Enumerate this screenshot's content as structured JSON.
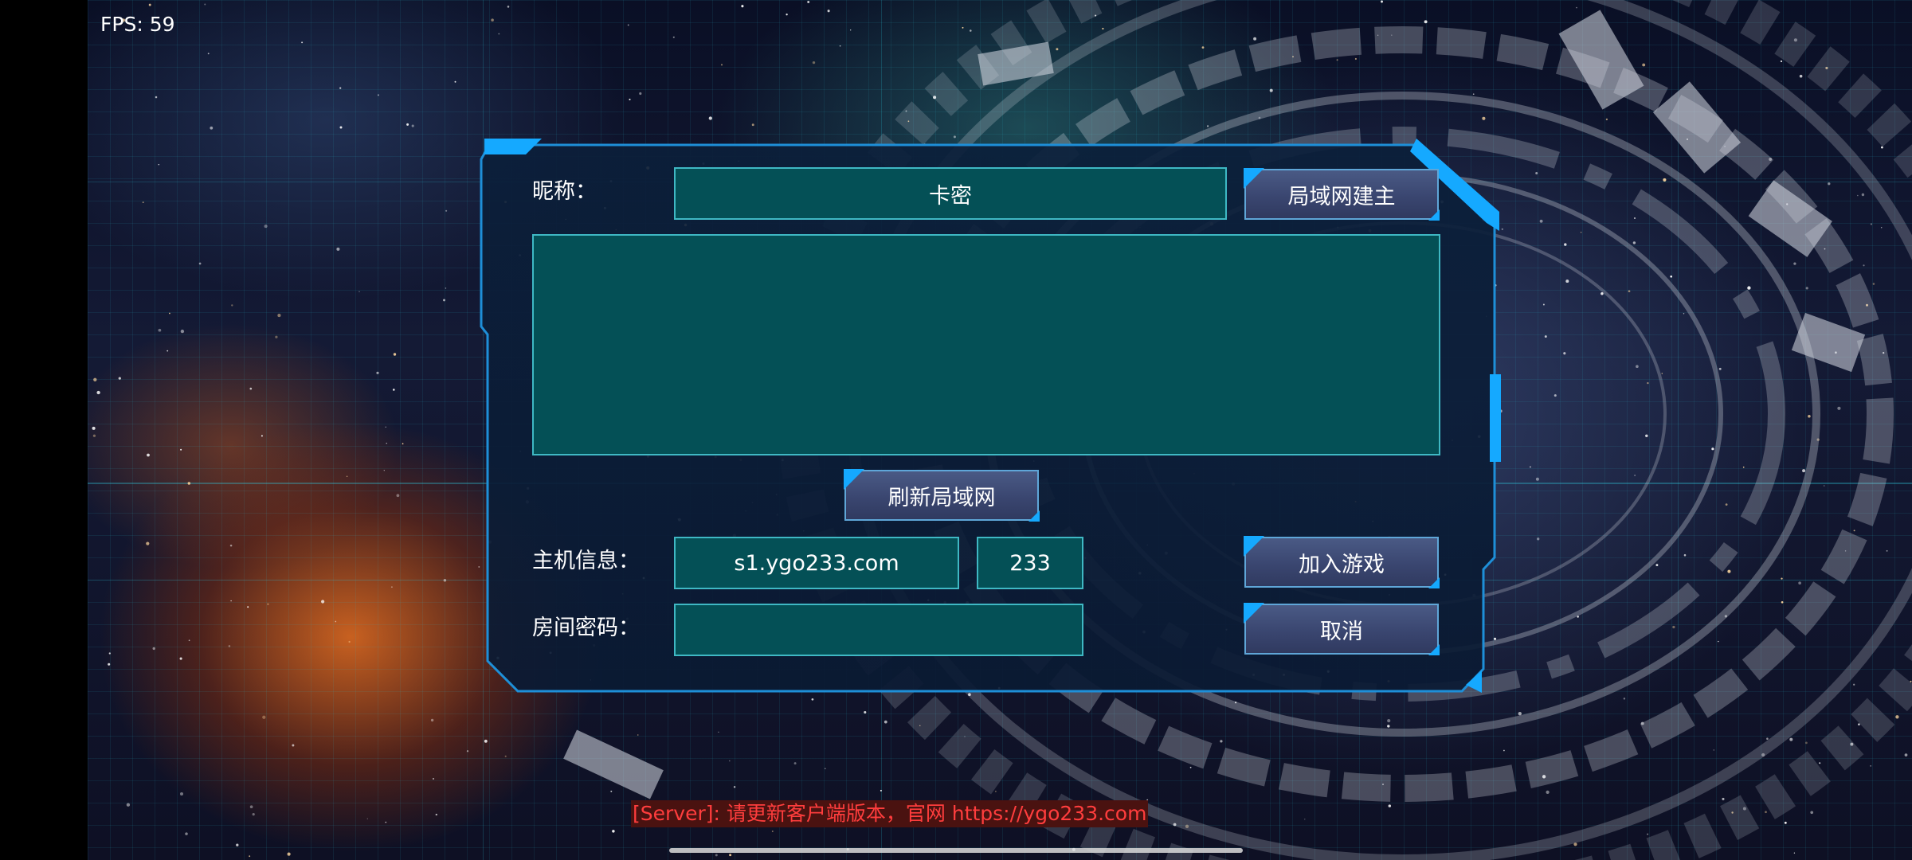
{
  "fps": "FPS: 59",
  "dialog": {
    "nickname_label": "昵称：",
    "nickname_value": "卡密",
    "lan_host_button": "局域网建主",
    "refresh_lan_button": "刷新局域网",
    "host_info_label": "主机信息：",
    "host_address": "s1.ygo233.com",
    "host_port": "233",
    "join_game_button": "加入游戏",
    "room_password_label": "房间密码：",
    "room_password_value": "",
    "cancel_button": "取消"
  },
  "server_message": "[Server]: 请更新客户端版本，官网 https://ygo233.com",
  "colors": {
    "field_bg": "#045056",
    "frame_accent": "#15a9ff",
    "server_text": "#ff3d3d",
    "button_bg": "#3a4670"
  }
}
